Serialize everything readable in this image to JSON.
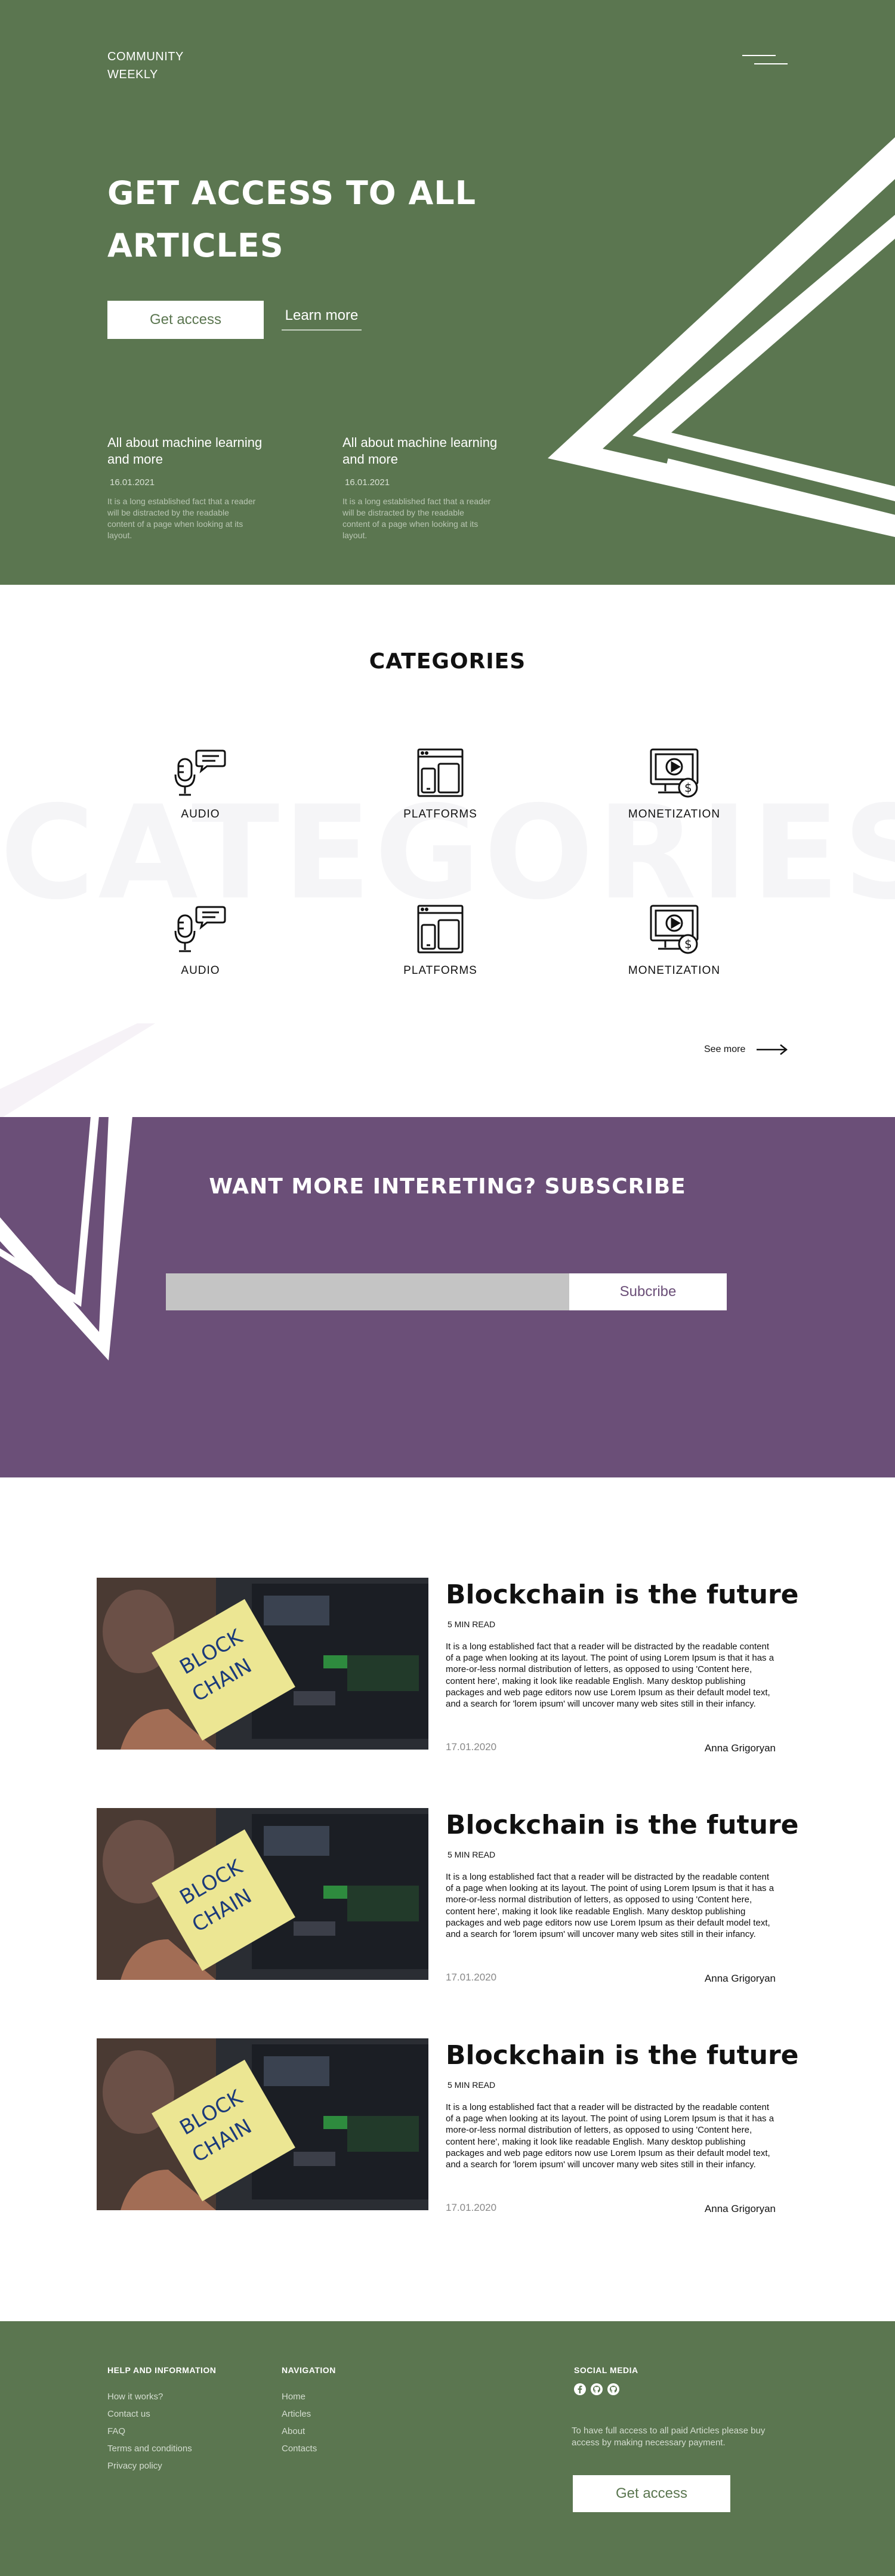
{
  "colors": {
    "hero_green": "#5b7650",
    "subscribe_purple": "#6b4f78",
    "white": "#ffffff"
  },
  "header": {
    "brand_line1": "COMMUNITY",
    "brand_line2": "WEEKLY",
    "menu_icon": "hamburger-icon"
  },
  "hero": {
    "title": "GET ACCESS TO ALL ARTICLES",
    "primary_button": "Get access",
    "secondary_link": "Learn more",
    "posts": [
      {
        "title": "All about machine learning and more",
        "date": "16.01.2021",
        "excerpt": "It is a long established fact that a reader will be distracted by the readable content of a page when looking at its layout."
      },
      {
        "title": "All about machine learning and more",
        "date": "16.01.2021",
        "excerpt": "It is a long established fact that a reader will be distracted by the readable content of a page when looking at its layout."
      }
    ]
  },
  "categories": {
    "title": "CATEGORIES",
    "background_word": "CATEGORIES",
    "items": [
      {
        "label": "AUDIO",
        "icon": "podcast-microphone-icon"
      },
      {
        "label": "PLATFORMS",
        "icon": "devices-icon"
      },
      {
        "label": "MONETIZATION",
        "icon": "video-monetization-icon"
      },
      {
        "label": "AUDIO",
        "icon": "podcast-microphone-icon"
      },
      {
        "label": "PLATFORMS",
        "icon": "devices-icon"
      },
      {
        "label": "MONETIZATION",
        "icon": "video-monetization-icon"
      }
    ],
    "see_more": "See more"
  },
  "subscribe": {
    "title": "WANT MORE INTERETING? SUBSCRIBE",
    "input_value": "",
    "button": "Subcribe"
  },
  "articles": [
    {
      "title": "Blockchain is the future",
      "read_time": "5 MIN READ",
      "body": "It is a long established fact that a reader will be distracted by the readable content of a page when looking at its layout. The point of using Lorem Ipsum is that it has a more-or-less normal distribution of letters, as opposed to using 'Content here, content here', making it look like readable English. Many desktop publishing packages and web page editors now use Lorem Ipsum as their default model text, and a search for 'lorem ipsum' will uncover many web sites still in their infancy.",
      "date": "17.01.2020",
      "author": "Anna Grigoryan",
      "image_text_1": "BLOCK",
      "image_text_2": "CHAIN"
    },
    {
      "title": "Blockchain is the future",
      "read_time": "5 MIN READ",
      "body": "It is a long established fact that a reader will be distracted by the readable content of a page when looking at its layout. The point of using Lorem Ipsum is that it has a more-or-less normal distribution of letters, as opposed to using 'Content here, content here', making it look like readable English. Many desktop publishing packages and web page editors now use Lorem Ipsum as their default model text, and a search for 'lorem ipsum' will uncover many web sites still in their infancy.",
      "date": "17.01.2020",
      "author": "Anna Grigoryan",
      "image_text_1": "BLOCK",
      "image_text_2": "CHAIN"
    },
    {
      "title": "Blockchain is the future",
      "read_time": "5 MIN READ",
      "body": "It is a long established fact that a reader will be distracted by the readable content of a page when looking at its layout. The point of using Lorem Ipsum is that it has a more-or-less normal distribution of letters, as opposed to using 'Content here, content here', making it look like readable English. Many desktop publishing packages and web page editors now use Lorem Ipsum as their default model text, and a search for 'lorem ipsum' will uncover many web sites still in their infancy.",
      "date": "17.01.2020",
      "author": "Anna Grigoryan",
      "image_text_1": "BLOCK",
      "image_text_2": "CHAIN"
    }
  ],
  "footer": {
    "help": {
      "title": "HELP AND INFORMATION",
      "links": [
        "How it works?",
        "Contact us",
        "FAQ",
        "Terms and conditions",
        "Privacy policy"
      ]
    },
    "navigation": {
      "title": "NAVIGATION",
      "links": [
        "Home",
        "Articles",
        "About",
        "Contacts"
      ]
    },
    "social": {
      "title": "SOCIAL MEDIA",
      "icons": [
        "facebook-icon",
        "github-icon",
        "github-icon"
      ]
    },
    "note": "To have full access to all paid Articles please buy access  by making  necessary payment.",
    "button": "Get access"
  }
}
